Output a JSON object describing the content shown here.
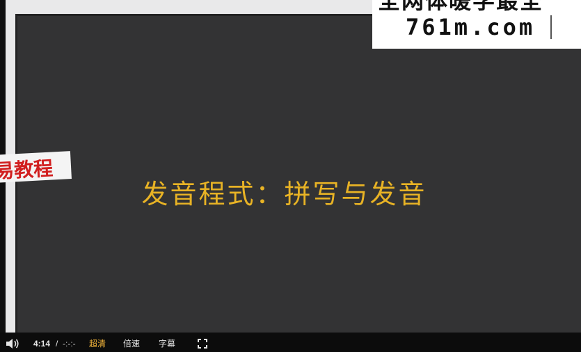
{
  "slide": {
    "title": "发音程式：拼写与发音"
  },
  "overlays": {
    "watermark_top": "全网体暖学最全",
    "watermark_site": "761m.com",
    "side_stamp": "易教程"
  },
  "player": {
    "current_time": "4:14",
    "separator": "/",
    "total_time": "-:-:-",
    "quality_label": "超清",
    "speed_label": "倍速",
    "subtitle_label": "字幕",
    "icons": {
      "volume": "volume-icon",
      "fullscreen": "fullscreen-icon"
    }
  },
  "colors": {
    "slide_background": "#333334",
    "title_text": "#e8b325",
    "quality_active": "#f2b43a",
    "stamp_red": "#d11f1f"
  }
}
